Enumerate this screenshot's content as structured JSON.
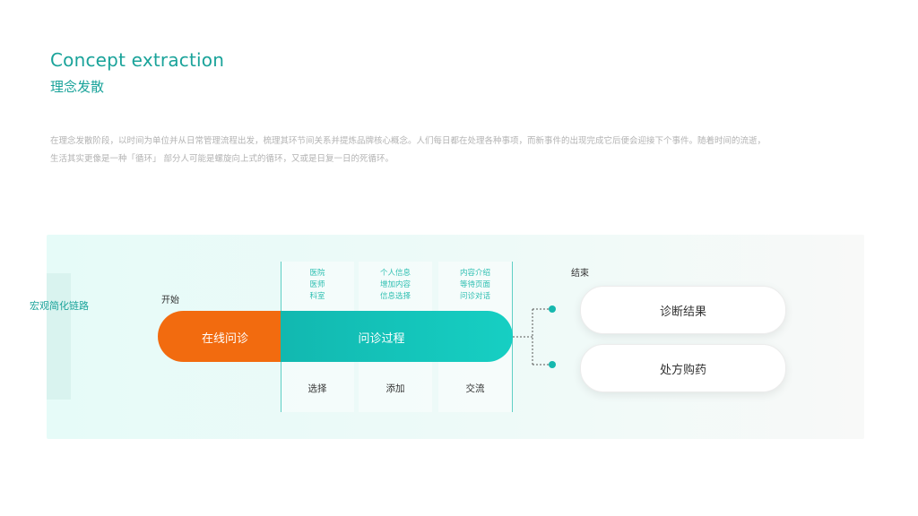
{
  "header": {
    "title_en": "Concept extraction",
    "title_cn": "理念发散"
  },
  "description": {
    "line1": "在理念发散阶段，以时间为单位并从日常管理流程出发，梳理其环节间关系并提炼品牌核心概念。人们每日都在处理各种事项，而新事件的出现完成它后便会迎接下个事件。随着时间的流逝，",
    "line2": "生活其实更像是一种「循环」 部分人可能是螺旋向上式的循环，又或是日复一日的死循环。"
  },
  "diagram": {
    "side_label": "宏观简化链路",
    "start_label": "开始",
    "end_label": "结束",
    "start_pill": "在线问诊",
    "process_pill": "问诊过程",
    "columns": [
      {
        "sub": [
          "医院",
          "医师",
          "科室"
        ],
        "action": "选择"
      },
      {
        "sub": [
          "个人信息",
          "增加内容",
          "信息选择"
        ],
        "action": "添加"
      },
      {
        "sub": [
          "内容介绍",
          "等待页面",
          "问诊对话"
        ],
        "action": "交流"
      }
    ],
    "results": [
      "诊断结果",
      "处方购药"
    ]
  },
  "colors": {
    "accent": "#1aa39a",
    "orange": "#f26b0f",
    "teal": "#16cfc3"
  }
}
